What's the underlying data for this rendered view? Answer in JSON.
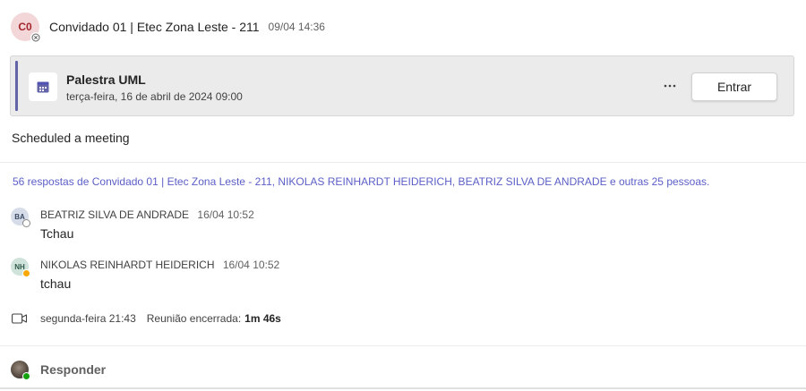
{
  "post": {
    "avatar_initials": "C0",
    "author": "Convidado 01 | Etec Zona Leste - 211",
    "timestamp": "09/04 14:36",
    "message": "Scheduled a meeting"
  },
  "meeting_card": {
    "title": "Palestra UML",
    "datetime": "terça-feira, 16 de abril de 2024 09:00",
    "more_label": "···",
    "join_label": "Entrar",
    "icon": "calendar-icon",
    "accent_color": "#6264a7"
  },
  "replies": {
    "summary": "56 respostas de Convidado 01 | Etec Zona Leste - 211, NIKOLAS REINHARDT HEIDERICH, BEATRIZ SILVA DE ANDRADE e outras 25 pessoas.",
    "link_color": "#5b5fc7",
    "items": [
      {
        "initials": "BA",
        "author": "BEATRIZ SILVA DE ANDRADE",
        "time": "16/04 10:52",
        "text": "Tchau",
        "avatar_bg": "#d6dde8",
        "avatar_fg": "#3b4a63",
        "status_color": "#8a8886"
      },
      {
        "initials": "NH",
        "author": "NIKOLAS REINHARDT HEIDERICH",
        "time": "16/04 10:52",
        "text": "tchau",
        "avatar_bg": "#cfe3da",
        "avatar_fg": "#2e5a4a",
        "status_color": "#f8a800"
      }
    ]
  },
  "meeting_ended": {
    "icon": "video-camera-icon",
    "when": "segunda-feira 21:43",
    "label": "Reunião encerrada:",
    "duration": "1m 46s"
  },
  "reply_bar": {
    "label": "Responder",
    "status_color": "#13a10e"
  }
}
